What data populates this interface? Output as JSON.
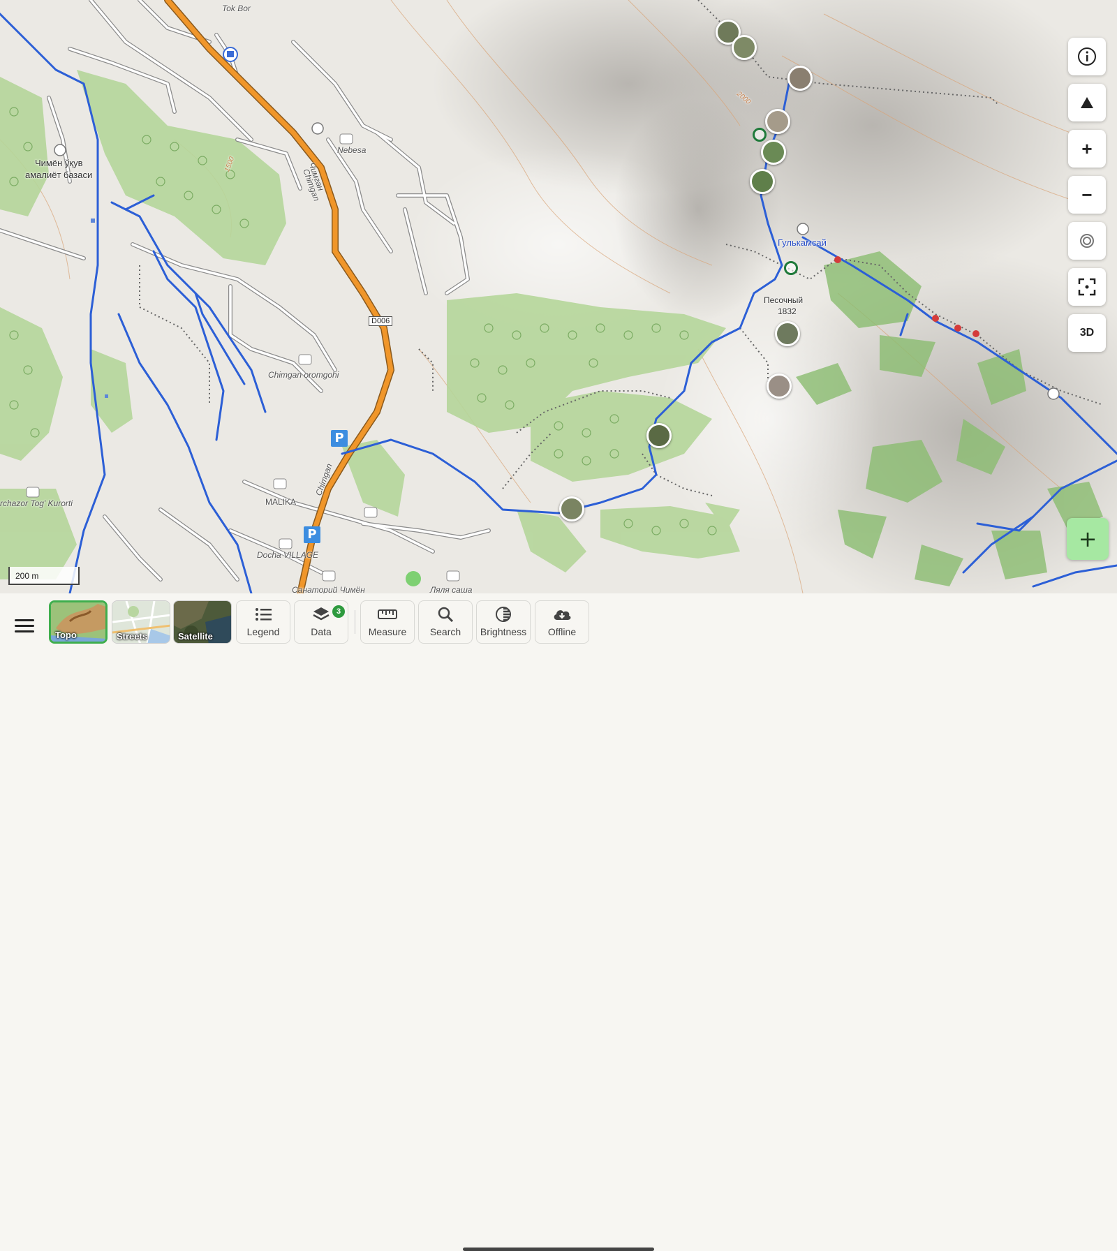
{
  "map": {
    "place_labels": [
      {
        "name": "Tok Bor"
      },
      {
        "name": "Nebesa"
      },
      {
        "name": "Chimgan oromgohi"
      },
      {
        "name": "MALIKA"
      },
      {
        "name": "Docha VILLAGE"
      },
      {
        "name": "Санаторий Чимён"
      },
      {
        "name": "Ляля саша"
      },
      {
        "name": "rchazor Tog' Kurorti"
      },
      {
        "name": "Чимён ўқув"
      },
      {
        "name": "амалиёт базаси"
      },
      {
        "name": "Чимган"
      },
      {
        "name": "Chimgan"
      },
      {
        "name": "Chimgan"
      }
    ],
    "peak_labels": {
      "gulkamsai": "Гулькамсай",
      "pesochny": "Песочный",
      "pesochny_elev": "1832"
    },
    "contour_labels": [
      "2000",
      "1500"
    ],
    "road_badge": "D006",
    "parking_label": "P",
    "scale_label": "200 m"
  },
  "controls": {
    "info_icon": "info-icon",
    "compass_icon": "north-arrow-icon",
    "zoom_in": "+",
    "zoom_out": "−",
    "location_icon": "location-target-icon",
    "fullscreen_icon": "fullscreen-icon",
    "three_d": "3D",
    "add": "+"
  },
  "toolbar": {
    "menu_icon": "hamburger-menu-icon",
    "layers": [
      {
        "label": "Topo",
        "active": true
      },
      {
        "label": "Streets",
        "active": false
      },
      {
        "label": "Satellite",
        "active": false
      }
    ],
    "tools": [
      {
        "label": "Legend",
        "icon": "list-icon"
      },
      {
        "label": "Data",
        "icon": "layers-icon",
        "badge": "3"
      },
      {
        "label": "Measure",
        "icon": "ruler-icon"
      },
      {
        "label": "Search",
        "icon": "search-icon"
      },
      {
        "label": "Brightness",
        "icon": "brightness-icon"
      },
      {
        "label": "Offline",
        "icon": "cloud-download-icon"
      }
    ]
  },
  "colors": {
    "trail": "#2c5fd6",
    "forest": "#b5d69a",
    "road_primary": "#f0962a",
    "accent_green": "#3fae4d"
  }
}
